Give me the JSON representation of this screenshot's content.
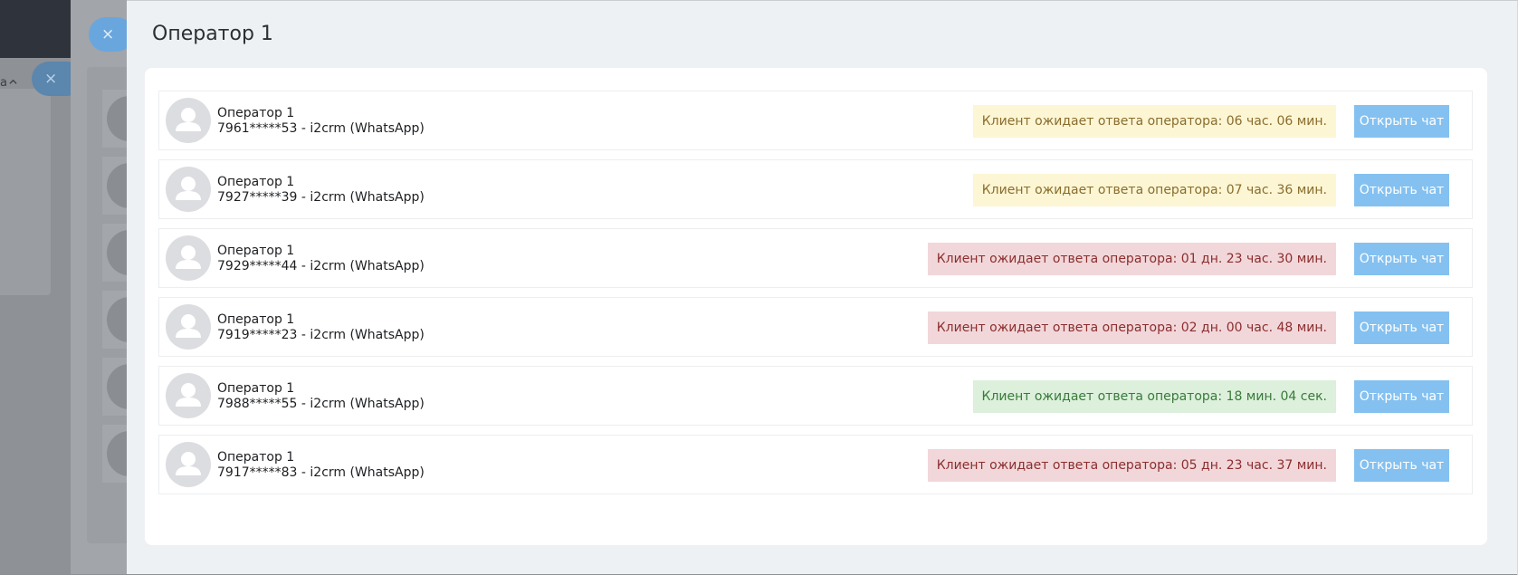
{
  "background": {
    "close_glyph_1": "×",
    "close_glyph_2": "×",
    "side_text": "а"
  },
  "modal": {
    "title": "Оператор 1"
  },
  "rows": [
    {
      "name": "Оператор 1",
      "contact": "7961*****53 - i2crm (WhatsApp)",
      "status": "Клиент ожидает ответа оператора: 06 час. 06 мин.",
      "status_kind": "warning",
      "button": "Открыть чат"
    },
    {
      "name": "Оператор 1",
      "contact": "7927*****39 - i2crm (WhatsApp)",
      "status": "Клиент ожидает ответа оператора: 07 час. 36 мин.",
      "status_kind": "warning",
      "button": "Открыть чат"
    },
    {
      "name": "Оператор 1",
      "contact": "7929*****44 - i2crm (WhatsApp)",
      "status": "Клиент ожидает ответа оператора: 01 дн. 23 час. 30 мин.",
      "status_kind": "danger",
      "button": "Открыть чат"
    },
    {
      "name": "Оператор 1",
      "contact": "7919*****23 - i2crm (WhatsApp)",
      "status": "Клиент ожидает ответа оператора: 02 дн. 00 час. 48 мин.",
      "status_kind": "danger",
      "button": "Открыть чат"
    },
    {
      "name": "Оператор 1",
      "contact": "7988*****55 - i2crm (WhatsApp)",
      "status": "Клиент ожидает ответа оператора: 18 мин. 04 сек.",
      "status_kind": "success",
      "button": "Открыть чат"
    },
    {
      "name": "Оператор 1",
      "contact": "7917*****83 - i2crm (WhatsApp)",
      "status": "Клиент ожидает ответа оператора: 05 дн. 23 час. 37 мин.",
      "status_kind": "danger",
      "button": "Открыть чат"
    }
  ],
  "colors": {
    "status_warning_bg": "#fcf6d4",
    "status_danger_bg": "#f2d7da",
    "status_success_bg": "#dcf0dc",
    "button_bg": "#84c1f0"
  },
  "icons": {
    "avatar": "user-placeholder-icon",
    "close": "close-icon"
  }
}
